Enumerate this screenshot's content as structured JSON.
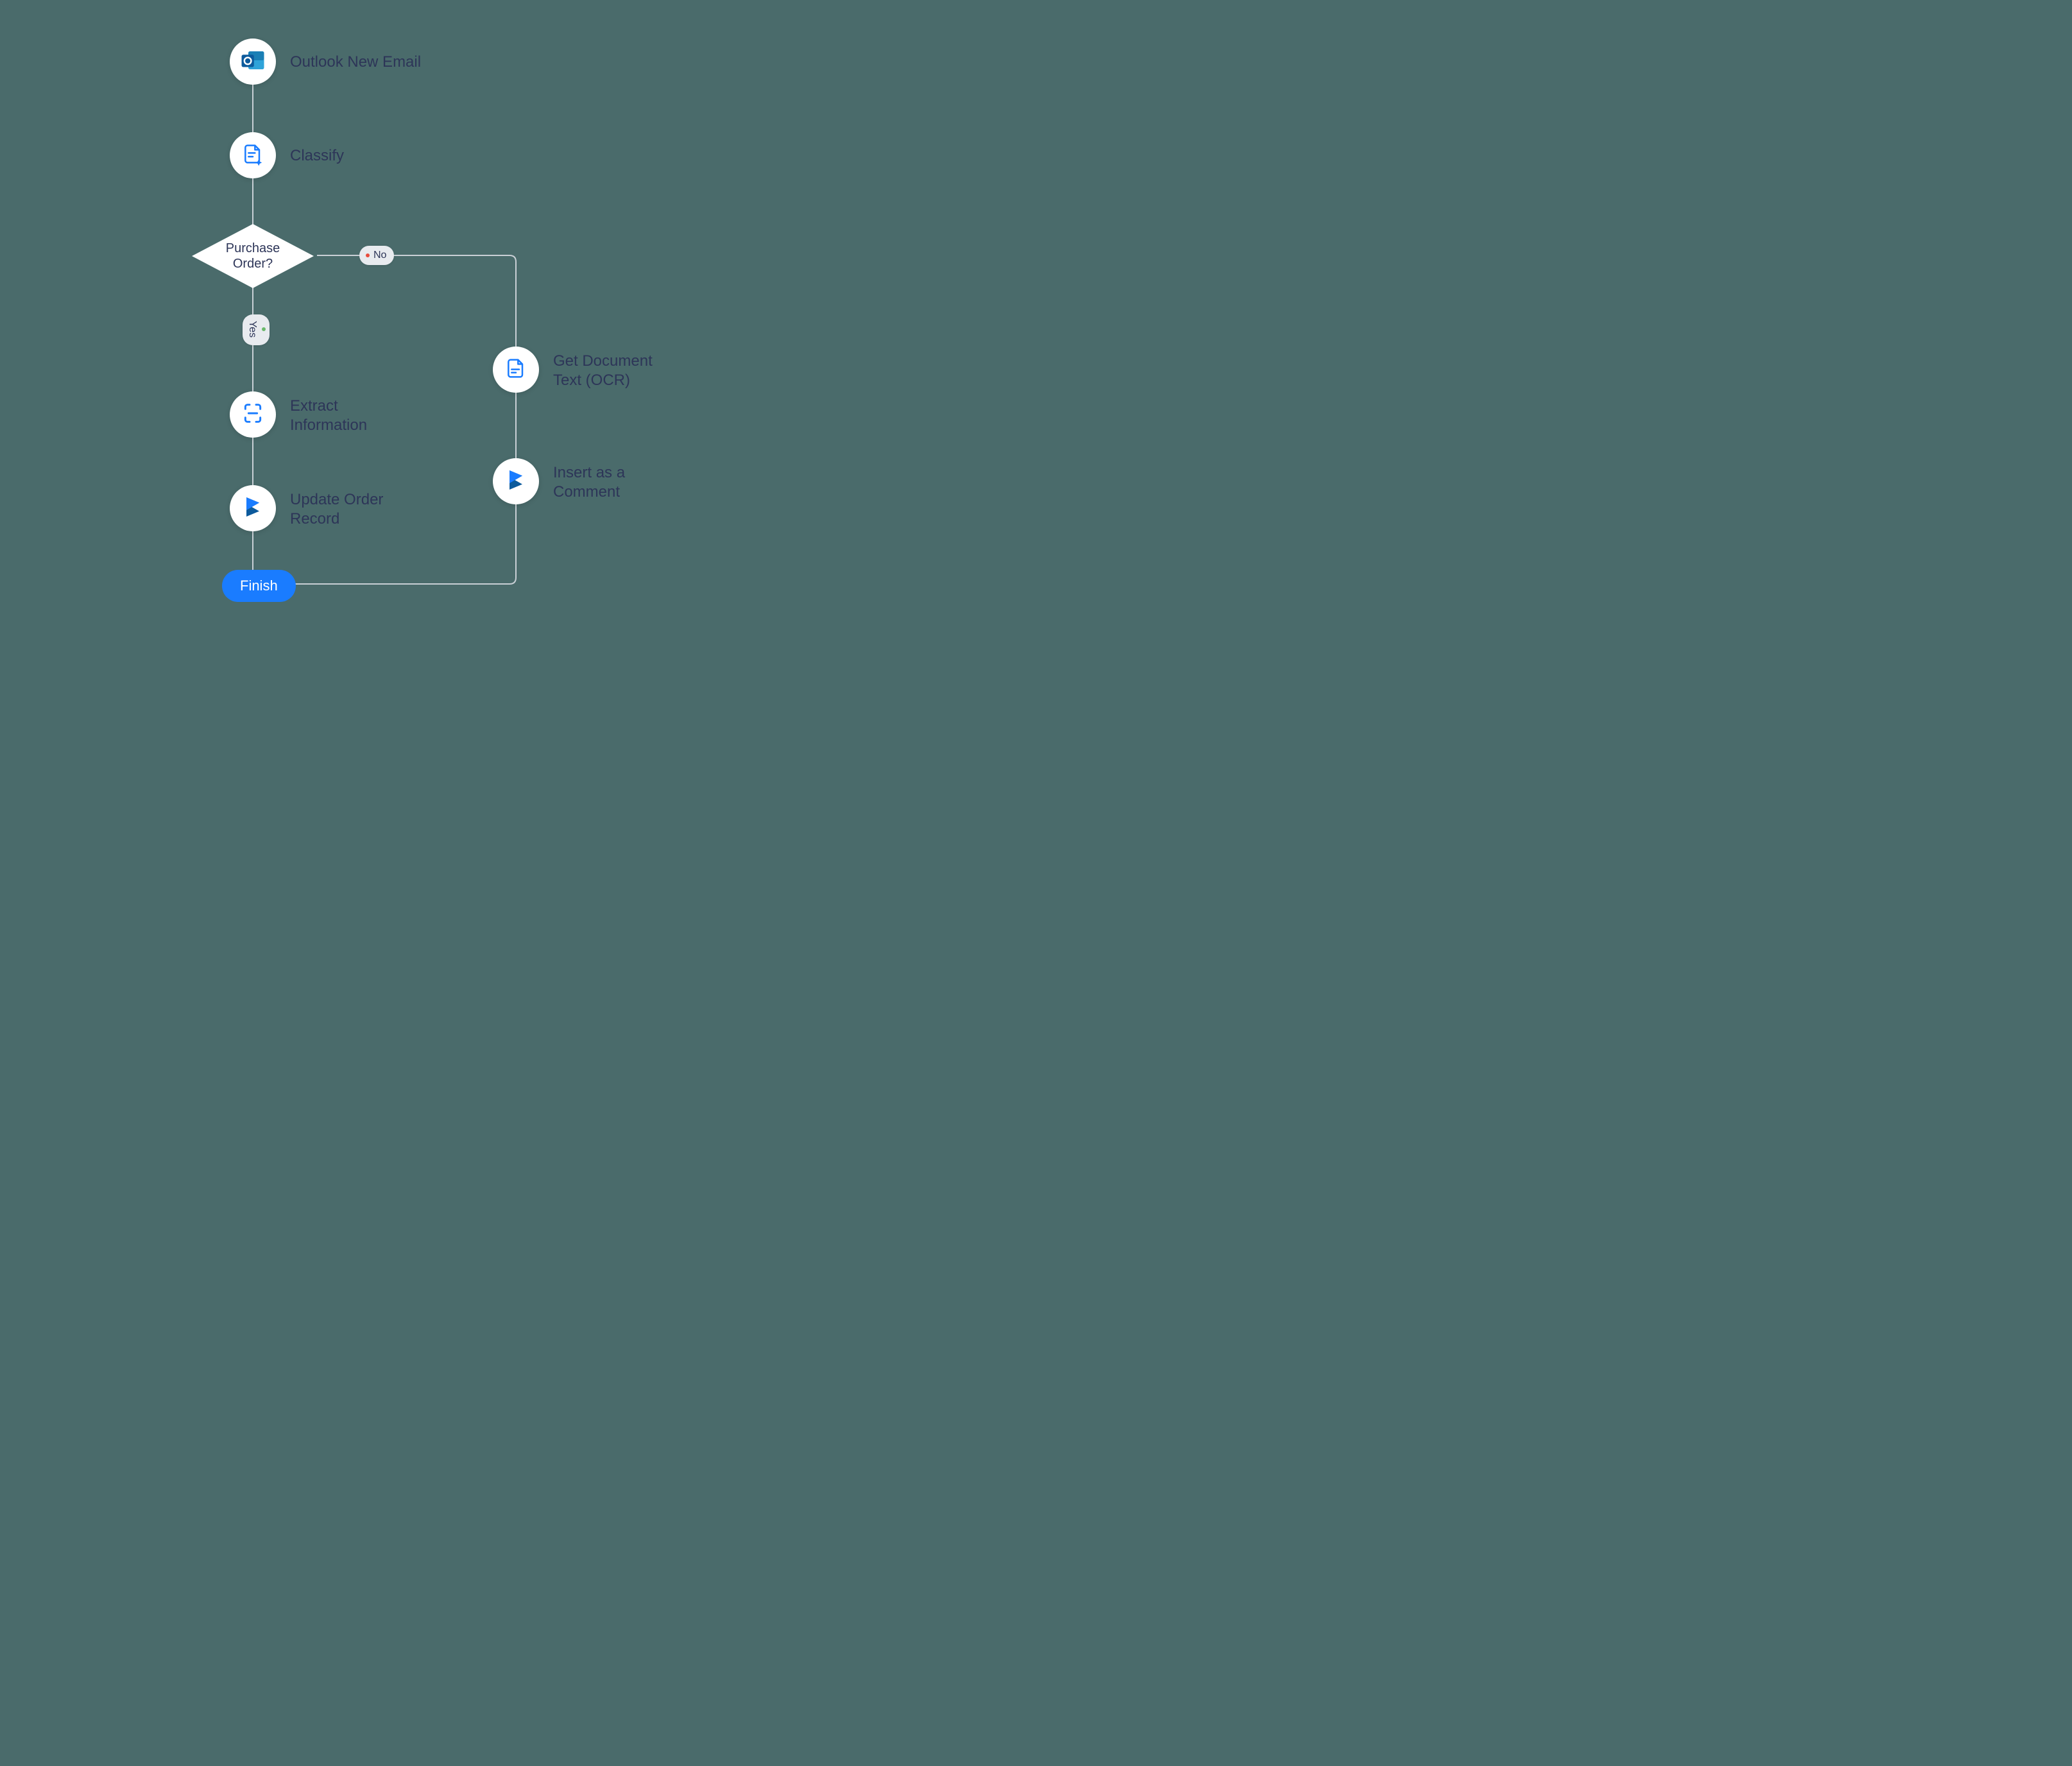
{
  "flowchart": {
    "nodes": {
      "outlook": {
        "label": "Outlook New Email",
        "icon": "outlook-icon"
      },
      "classify": {
        "label": "Classify",
        "icon": "document-sparkle-icon"
      },
      "decision": {
        "label": "Purchase\nOrder?"
      },
      "extract": {
        "label": "Extract\nInformation",
        "icon": "scan-icon"
      },
      "update": {
        "label": "Update Order\nRecord",
        "icon": "dynamics-icon"
      },
      "ocr": {
        "label": "Get Document\nText (OCR)",
        "icon": "document-lines-icon"
      },
      "insert": {
        "label": "Insert as a\nComment",
        "icon": "dynamics-icon"
      },
      "finish": {
        "label": "Finish"
      }
    },
    "branches": {
      "yes": "Yes",
      "no": "No"
    }
  }
}
